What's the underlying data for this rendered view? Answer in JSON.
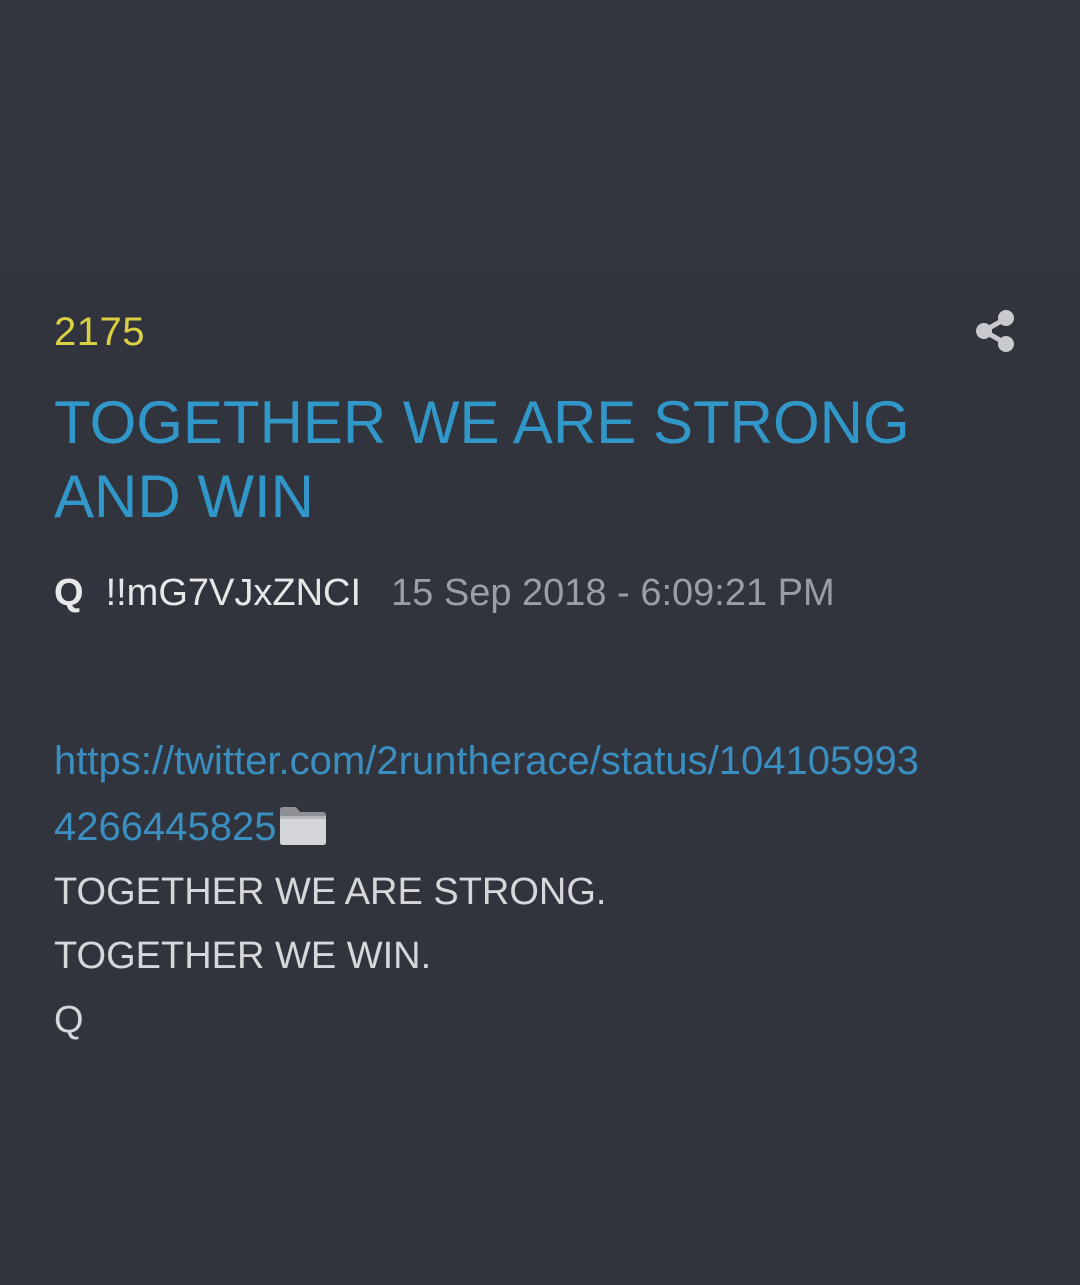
{
  "post": {
    "number": "2175",
    "title": "TOGETHER WE ARE STRONG AND WIN",
    "author": "Q",
    "tripcode": "!!mG7VJxZNCI",
    "timestamp": "15 Sep 2018 - 6:09:21 PM",
    "link_line_1": "https://twitter.com/2runtherace/status/104105993",
    "link_line_2": "4266445825",
    "lines": [
      "TOGETHER WE ARE STRONG.",
      "TOGETHER WE WIN.",
      "Q"
    ]
  },
  "icons": {
    "share": "share-icon",
    "folder": "folder-icon"
  },
  "colors": {
    "background": "#31343d",
    "post_number": "#d9d043",
    "title": "#3196c8",
    "link": "#3a8fc0",
    "body_text": "#d6d7da",
    "timestamp": "#9b9ea6"
  }
}
